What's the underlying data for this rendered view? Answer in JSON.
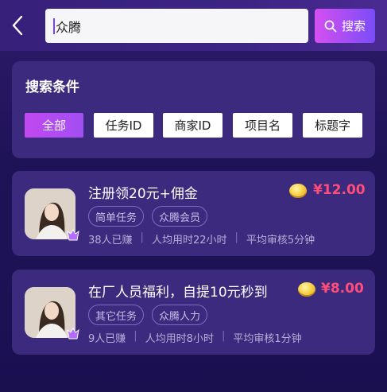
{
  "search": {
    "value": "众腾",
    "button_label": "搜索"
  },
  "filter": {
    "title": "搜索条件",
    "options": [
      "全部",
      "任务ID",
      "商家ID",
      "项目名",
      "标题字"
    ],
    "active_index": 0
  },
  "tasks": [
    {
      "title": "注册领20元+佣金",
      "price": "¥12.00",
      "tags": [
        "简单任务",
        "众腾会员"
      ],
      "earned": "38人已赚",
      "avg_time": "人均用时22小时",
      "review": "平均审核5分钟"
    },
    {
      "title": "在厂人员福利，自提10元秒到",
      "price": "¥8.00",
      "tags": [
        "其它任务",
        "众腾人力"
      ],
      "earned": "9人已赚",
      "avg_time": "人均用时8小时",
      "review": "平均审核1分钟"
    }
  ],
  "colors": {
    "accent": "#c248f0",
    "price": "#ff4d7a",
    "card": "#3b2a7e"
  }
}
